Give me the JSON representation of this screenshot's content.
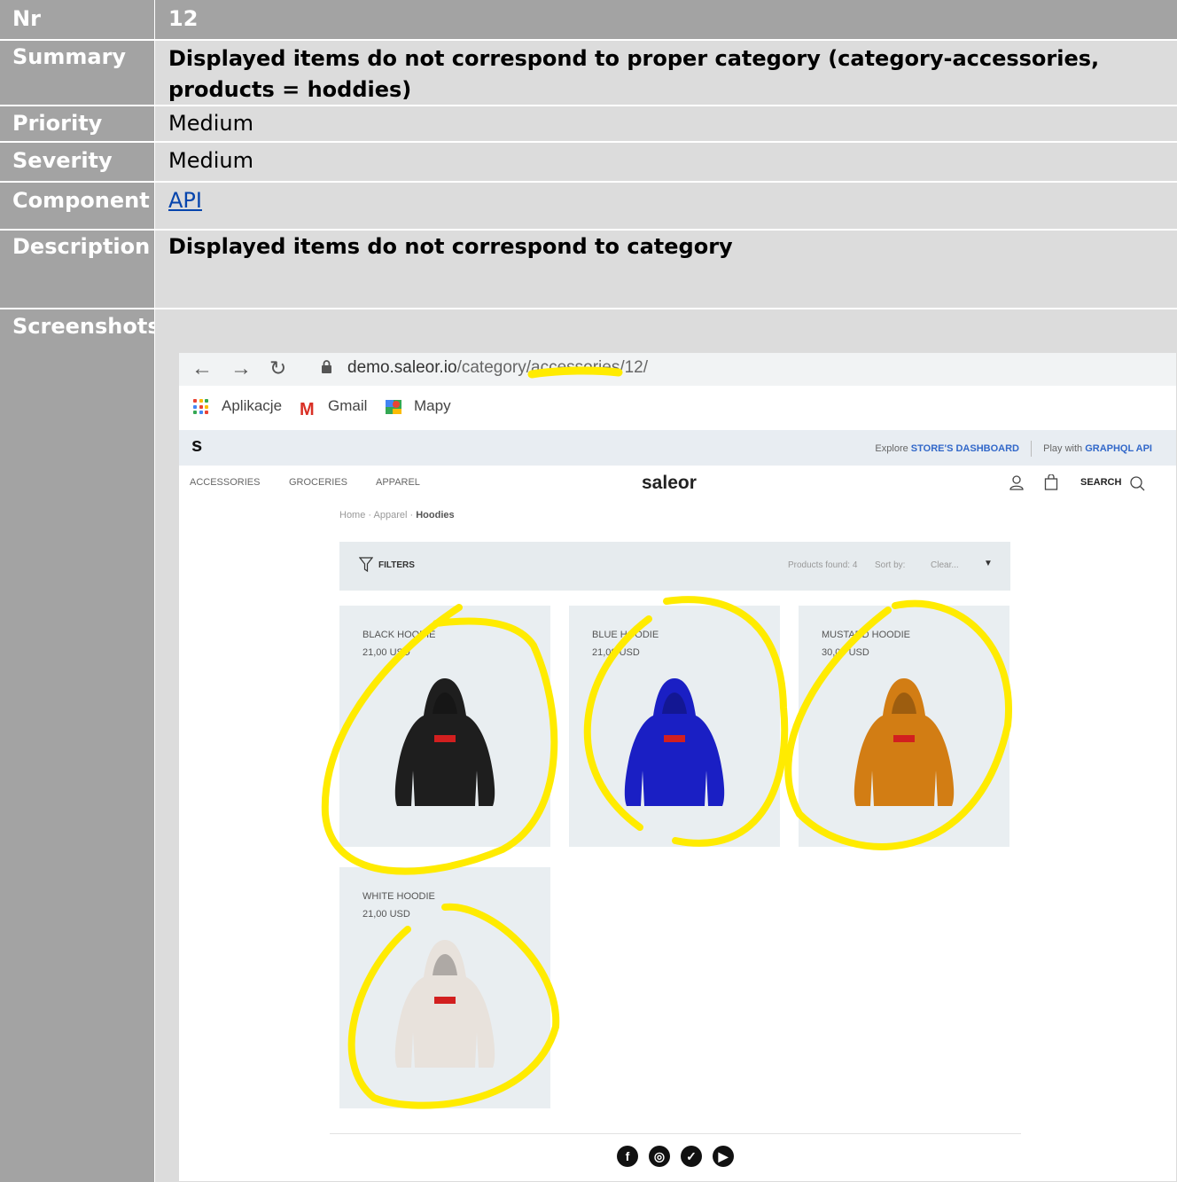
{
  "nr": {
    "label": "Nr",
    "value": "12"
  },
  "summary": {
    "label": "Summary",
    "value": "Displayed items do not correspond to proper category (category-accessories, products = hoddies)"
  },
  "priority": {
    "label": "Priority",
    "value": "Medium"
  },
  "severity": {
    "label": "Severity",
    "value": "Medium"
  },
  "component": {
    "label": "Component",
    "value": "API"
  },
  "description": {
    "label": "Description",
    "value": "Displayed items do not correspond to category"
  },
  "screenshots": {
    "label": "Screenshots"
  },
  "browser": {
    "url_host": "demo.saleor.io",
    "url_path": "/category/accessories/12/",
    "bookmarks": [
      "Aplikacje",
      "Gmail",
      "Mapy"
    ]
  },
  "store": {
    "logo": "s",
    "explore_prefix": "Explore",
    "dashboard_link": "STORE'S DASHBOARD",
    "play_prefix": "Play with",
    "graphql_link": "GRAPHQL API",
    "nav": [
      "ACCESSORIES",
      "GROCERIES",
      "APPAREL"
    ],
    "brand": "saleor",
    "search_label": "SEARCH",
    "breadcrumb": [
      "Home",
      "Apparel",
      "Hoodies"
    ],
    "filters_label": "FILTERS",
    "products_found": "Products found: 4",
    "sort_by": "Sort by:",
    "sort_value": "Clear...",
    "products": [
      {
        "name": "BLACK HOODIE",
        "price": "21,00 USD",
        "color": "#1e1e1e"
      },
      {
        "name": "BLUE HOODIE",
        "price": "21,00 USD",
        "color": "#1a1fc4"
      },
      {
        "name": "MUSTARD HOODIE",
        "price": "30,00 USD",
        "color": "#d27d14"
      },
      {
        "name": "WHITE HOODIE",
        "price": "21,00 USD",
        "color": "#e8e2dc"
      }
    ],
    "social_icons": [
      "facebook-icon",
      "instagram-icon",
      "twitter-icon",
      "youtube-icon"
    ]
  },
  "highlight_color": "#ffeb00"
}
